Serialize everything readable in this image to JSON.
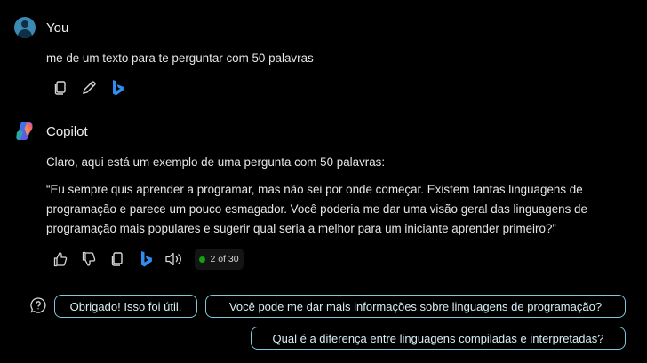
{
  "user": {
    "name": "You",
    "message": "me de um texto para te perguntar com 50 palavras"
  },
  "copilot": {
    "name": "Copilot",
    "intro": "Claro, aqui está um exemplo de uma pergunta com 50 palavras:",
    "quote_lines": [
      "“Eu sempre quis aprender a programar, mas não sei por onde começar. Existem tantas linguagens de",
      "programação e parece um pouco esmagador. Você poderia me dar uma visão geral das linguagens de",
      "programação mais populares e sugerir qual seria a melhor para um iniciante aprender primeiro?”"
    ],
    "response_counter": "2 of 30"
  },
  "suggestions": [
    "Obrigado! Isso foi útil.",
    "Você pode me dar mais informações sobre linguagens de programação?",
    "Qual é a diferença entre linguagens compiladas e interpretadas?"
  ],
  "icons": {
    "user_actions": [
      "copy-icon",
      "edit-icon",
      "bing-icon"
    ],
    "copilot_actions": [
      "thumbs-up-icon",
      "thumbs-down-icon",
      "copy-icon",
      "bing-icon",
      "speaker-icon"
    ],
    "suggestion_help": "question-chat-icon"
  },
  "colors": {
    "background": "#000000",
    "chip_border": "#7fc7d9",
    "counter_dot": "#13a10e",
    "bing_blue": "#2f8cf0"
  }
}
